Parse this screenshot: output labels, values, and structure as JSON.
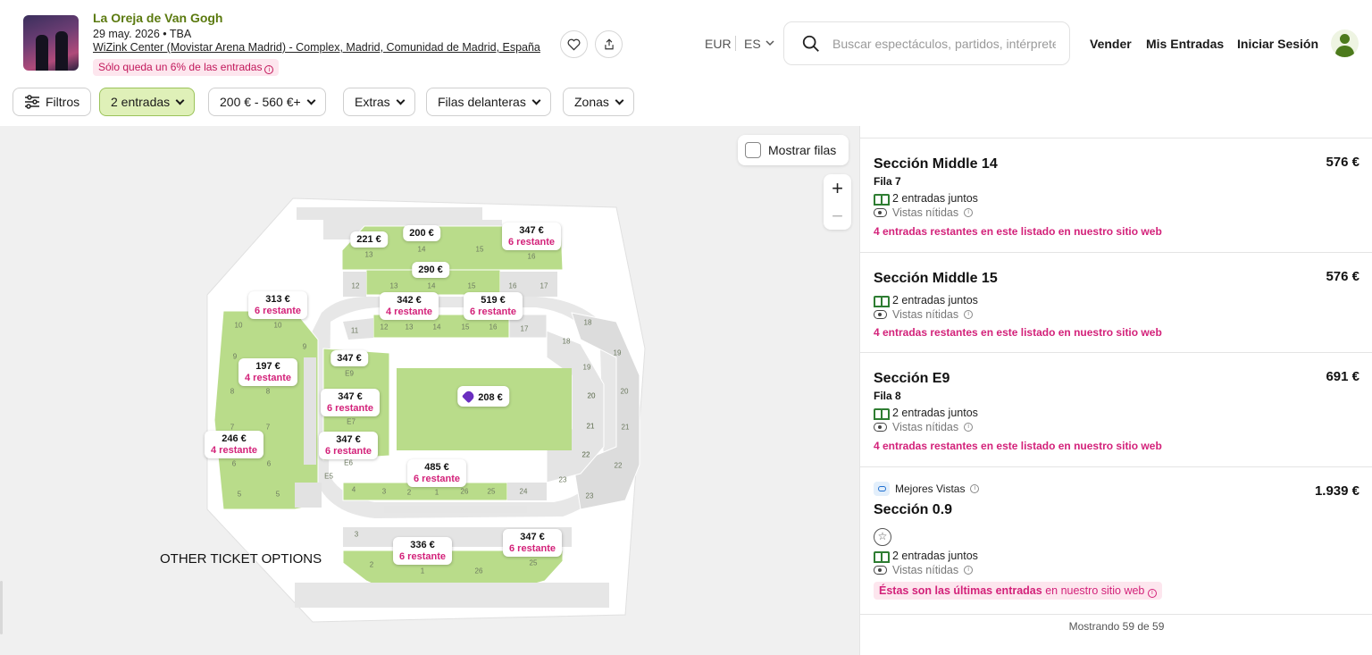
{
  "event": {
    "title": "La Oreja de Van Gogh",
    "date": "29 may. 2026 • TBA",
    "venue": "WiZink Center (Movistar Arena Madrid) - Complex, Madrid, Comunidad de Madrid, España",
    "scarcity": "Sólo queda un 6% de las entradas"
  },
  "header": {
    "currency": "EUR",
    "language": "ES",
    "search_placeholder": "Buscar espectáculos, partidos, intérpretes",
    "sell": "Vender",
    "my_tickets": "Mis Entradas",
    "login": "Iniciar Sesión"
  },
  "filters": {
    "filters_label": "Filtros",
    "quantity": "2 entradas",
    "price_range": "200 € - 560 €+",
    "extras": "Extras",
    "front_rows": "Filas delanteras",
    "zones": "Zonas"
  },
  "map": {
    "show_rows": "Mostrar filas",
    "zoom_in": "+",
    "zoom_out": "−",
    "other_options": "OTHER TICKET OPTIONS",
    "price_labels": [
      {
        "price": "221 €",
        "remaining": ""
      },
      {
        "price": "200 €",
        "remaining": ""
      },
      {
        "price": "347 €",
        "remaining": "6 restante"
      },
      {
        "price": "290 €",
        "remaining": ""
      },
      {
        "price": "313 €",
        "remaining": "6 restante"
      },
      {
        "price": "342 €",
        "remaining": "4 restante"
      },
      {
        "price": "519 €",
        "remaining": "6 restante"
      },
      {
        "price": "347 €",
        "remaining": ""
      },
      {
        "price": "197 €",
        "remaining": "4 restante"
      },
      {
        "price": "347 €",
        "remaining": "6 restante"
      },
      {
        "price": "208 €",
        "remaining": ""
      },
      {
        "price": "246 €",
        "remaining": "4 restante"
      },
      {
        "price": "347 €",
        "remaining": "6 restante"
      },
      {
        "price": "485 €",
        "remaining": "6 restante"
      },
      {
        "price": "336 €",
        "remaining": "6 restante"
      },
      {
        "price": "347 €",
        "remaining": "6 restante"
      }
    ],
    "section_numbers": [
      "13",
      "14",
      "15",
      "16",
      "12",
      "13",
      "14",
      "15",
      "16",
      "17",
      "11",
      "12",
      "13",
      "14",
      "15",
      "16",
      "17",
      "18",
      "10",
      "10",
      "9",
      "9",
      "8",
      "8",
      "7",
      "7",
      "6",
      "6",
      "5",
      "5",
      "4",
      "3",
      "2",
      "1",
      "26",
      "25",
      "24",
      "23",
      "22",
      "21",
      "20",
      "19",
      "3",
      "2",
      "1",
      "26",
      "25",
      "E9",
      "E7",
      "E6",
      "E5",
      "18",
      "19",
      "20",
      "21",
      "22",
      "23",
      "22",
      "21",
      "20"
    ]
  },
  "listings": [
    {
      "section": "Sección Middle 14",
      "row": "Fila 7",
      "price": "576 €",
      "together": "2 entradas juntos",
      "views": "Vistas nítidas",
      "remaining": "4 entradas restantes en este listado en nuestro sitio web"
    },
    {
      "section": "Sección Middle 15",
      "row": "",
      "price": "576 €",
      "together": "2 entradas juntos",
      "views": "Vistas nítidas",
      "remaining": "4 entradas restantes en este listado en nuestro sitio web"
    },
    {
      "section": "Sección E9",
      "row": "Fila 8",
      "price": "691 €",
      "together": "2 entradas juntos",
      "views": "Vistas nítidas",
      "remaining": "4 entradas restantes en este listado en nuestro sitio web"
    },
    {
      "section": "Sección 0.9",
      "badge": "Mejores Vistas",
      "price": "1.939 €",
      "together": "2 entradas juntos",
      "views": "Vistas nítidas",
      "last_bold": "Éstas son las últimas entradas",
      "last_rest": "en nuestro sitio web"
    }
  ],
  "showing": "Mostrando 59 de 59",
  "colors": {
    "accent_green": "#b9dc8a",
    "brand_green": "#5b7a0f",
    "pink": "#d3227a",
    "grey_section": "#dcdcdc"
  }
}
